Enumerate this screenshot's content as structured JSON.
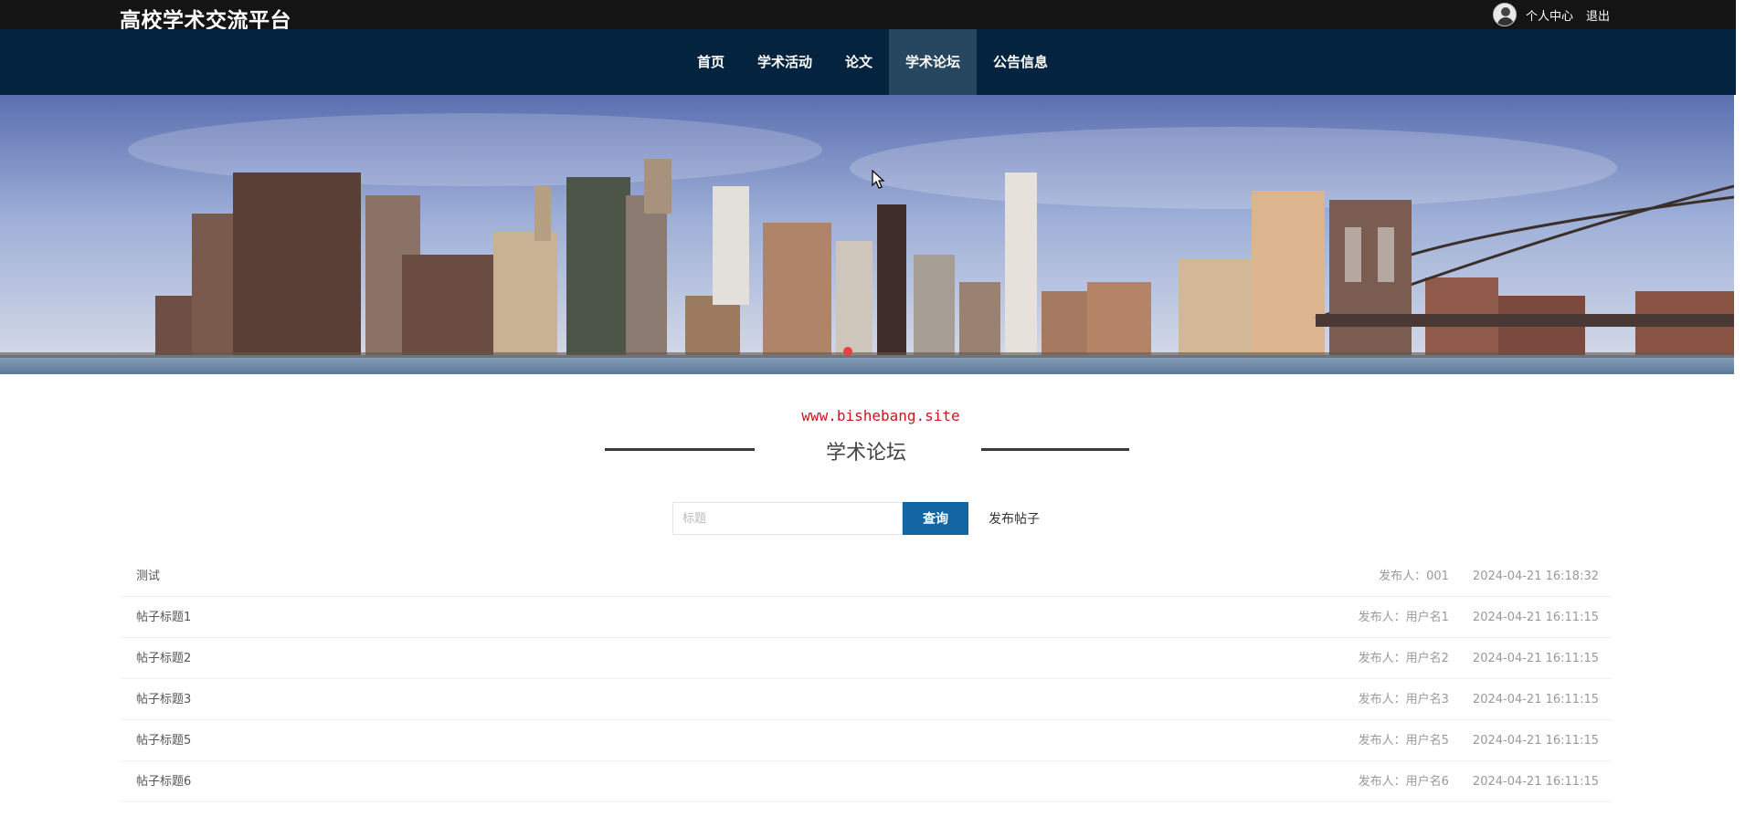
{
  "header": {
    "brand": "高校学术交流平台",
    "user_center": "个人中心",
    "logout": "退出"
  },
  "nav": {
    "items": [
      {
        "label": "首页"
      },
      {
        "label": "学术活动"
      },
      {
        "label": "论文"
      },
      {
        "label": "学术论坛"
      },
      {
        "label": "公告信息"
      }
    ],
    "active": "学术论坛"
  },
  "section": {
    "watermark": "www.bishebang.site",
    "title": "学术论坛"
  },
  "search": {
    "placeholder": "标题",
    "value": "",
    "query_label": "查询",
    "post_label": "发布帖子"
  },
  "posts": [
    {
      "title": "测试",
      "author": "发布人：001",
      "time": "2024-04-21 16:18:32"
    },
    {
      "title": "帖子标题1",
      "author": "发布人：用户名1",
      "time": "2024-04-21 16:11:15"
    },
    {
      "title": "帖子标题2",
      "author": "发布人：用户名2",
      "time": "2024-04-21 16:11:15"
    },
    {
      "title": "帖子标题3",
      "author": "发布人：用户名3",
      "time": "2024-04-21 16:11:15"
    },
    {
      "title": "帖子标题5",
      "author": "发布人：用户名5",
      "time": "2024-04-21 16:11:15"
    },
    {
      "title": "帖子标题6",
      "author": "发布人：用户名6",
      "time": "2024-04-21 16:11:15"
    }
  ],
  "colors": {
    "topbar": "#141414",
    "navbar": "#04233e",
    "nav_active": "#27465f",
    "query_button": "#1266a4",
    "watermark": "#c8171e"
  }
}
